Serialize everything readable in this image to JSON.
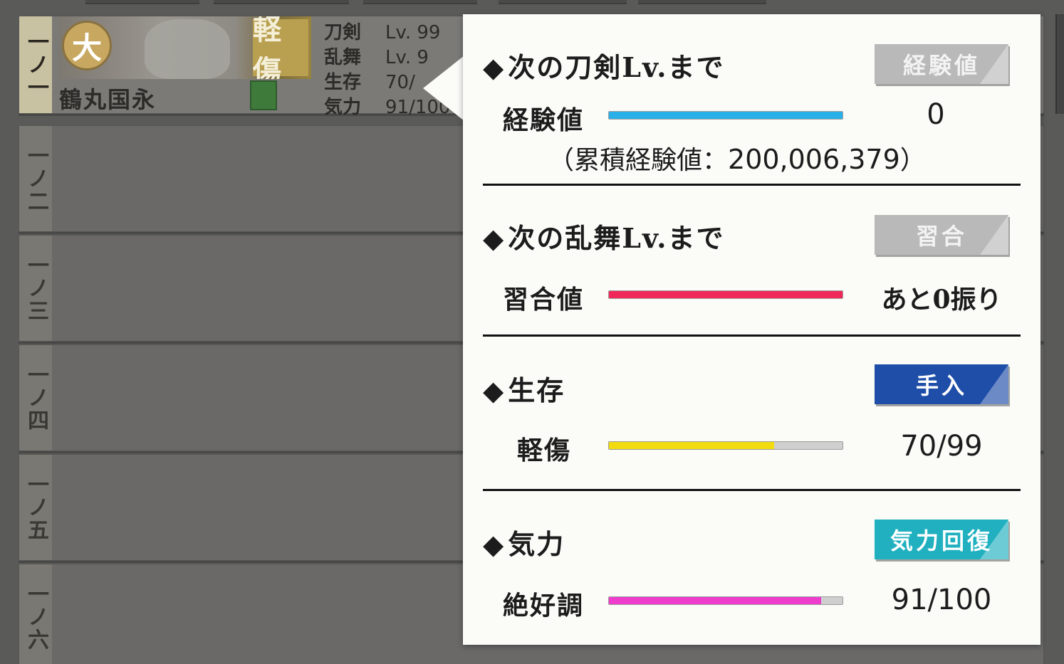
{
  "roster": {
    "rows": [
      {
        "slot": "一ノ一"
      },
      {
        "slot": "一ノ二"
      },
      {
        "slot": "一ノ三"
      },
      {
        "slot": "一ノ四"
      },
      {
        "slot": "一ノ五"
      },
      {
        "slot": "一ノ六"
      }
    ],
    "active": {
      "crest_glyph": "大",
      "injury_badge": "軽傷",
      "name": "鶴丸国永",
      "stats": [
        {
          "label": "刀剣",
          "value": "Lv.  99"
        },
        {
          "label": "乱舞",
          "value": "Lv.   9"
        },
        {
          "label": "生存",
          "value": "  70/"
        },
        {
          "label": "気力",
          "value": "91/100"
        }
      ]
    }
  },
  "popup": {
    "sword_level": {
      "title": "次の刀剣Lv.まで",
      "button": "経験値",
      "bar_label": "経験値",
      "value": "0",
      "cumulative_prefix": "（累積経験値：",
      "cumulative_value": "200,006,379",
      "cumulative_suffix": "）",
      "fill_percent": 100,
      "color": "#2ab0e8"
    },
    "ranbu_level": {
      "title": "次の乱舞Lv.まで",
      "button": "習合",
      "bar_label": "習合値",
      "value": "あと0振り",
      "fill_percent": 100,
      "color": "#f0285a"
    },
    "survival": {
      "title": "生存",
      "button": "手入",
      "bar_label": "軽傷",
      "value": "70/99",
      "fill_percent": 70.7,
      "color": "#f2dc10"
    },
    "morale": {
      "title": "気力",
      "button": "気力回復",
      "bar_label": "絶好調",
      "value": "91/100",
      "fill_percent": 91,
      "color": "#ee3ccc"
    }
  }
}
